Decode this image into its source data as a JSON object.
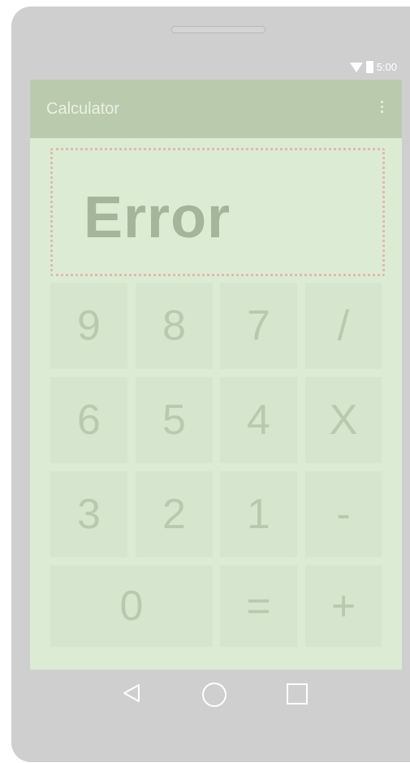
{
  "status_bar": {
    "time": "5:00",
    "icons": [
      "wifi-icon",
      "battery-icon"
    ]
  },
  "app_bar": {
    "title": "Calculator",
    "menu_icon": "overflow-menu-icon"
  },
  "display": {
    "value": "Error"
  },
  "keypad": {
    "rows": [
      [
        "9",
        "8",
        "7",
        "/"
      ],
      [
        "6",
        "5",
        "4",
        "X"
      ],
      [
        "3",
        "2",
        "1",
        "-"
      ],
      [
        "0",
        "=",
        "+"
      ]
    ]
  },
  "nav_bar": {
    "icons": [
      "back-icon",
      "home-icon",
      "recents-icon"
    ]
  },
  "colors": {
    "phone_frame": "#cfcfcf",
    "app_bar": "#b9cbac",
    "content_background": "#dcebd3",
    "key_background": "#d6e5cd",
    "key_text": "#b9c9b0",
    "display_text": "#a5b59b",
    "display_border": "#e3b9aa"
  }
}
